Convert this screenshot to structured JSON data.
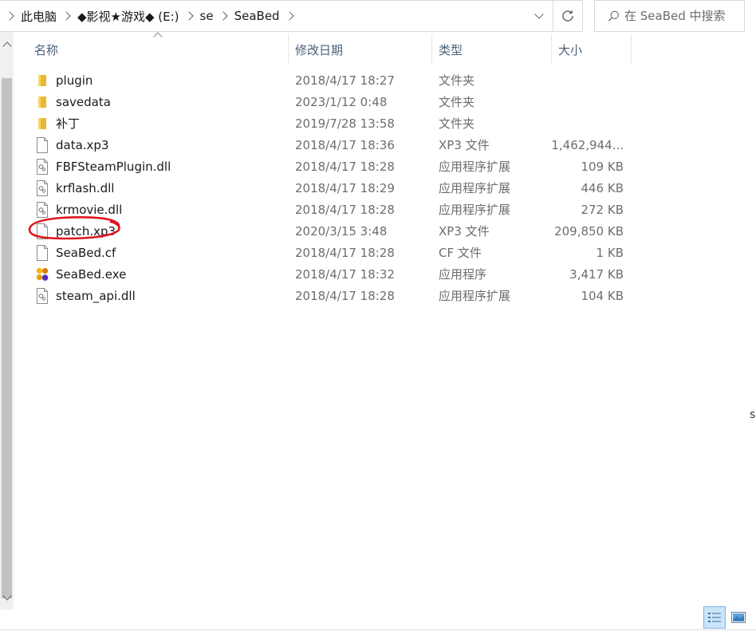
{
  "breadcrumb": [
    {
      "label": "此电脑"
    },
    {
      "label": "◆影视★游戏◆ (E:)"
    },
    {
      "label": "se"
    },
    {
      "label": "SeaBed"
    }
  ],
  "search": {
    "placeholder": "在 SeaBed 中搜索"
  },
  "columns": {
    "name": "名称",
    "date": "修改日期",
    "type": "类型",
    "size": "大小"
  },
  "files": [
    {
      "name": "plugin",
      "date": "2018/4/17 18:27",
      "type": "文件夹",
      "size": "",
      "icon": "folder-icon"
    },
    {
      "name": "savedata",
      "date": "2023/1/12 0:48",
      "type": "文件夹",
      "size": "",
      "icon": "folder-icon"
    },
    {
      "name": "补丁",
      "date": "2019/7/28 13:58",
      "type": "文件夹",
      "size": "",
      "icon": "folder-icon"
    },
    {
      "name": "data.xp3",
      "date": "2018/4/17 18:36",
      "type": "XP3 文件",
      "size": "1,462,944...",
      "icon": "file-icon"
    },
    {
      "name": "FBFSteamPlugin.dll",
      "date": "2018/4/17 18:28",
      "type": "应用程序扩展",
      "size": "109 KB",
      "icon": "dll-icon"
    },
    {
      "name": "krflash.dll",
      "date": "2018/4/17 18:29",
      "type": "应用程序扩展",
      "size": "446 KB",
      "icon": "dll-icon"
    },
    {
      "name": "krmovie.dll",
      "date": "2018/4/17 18:28",
      "type": "应用程序扩展",
      "size": "272 KB",
      "icon": "dll-icon"
    },
    {
      "name": "patch.xp3",
      "date": "2020/3/15 3:48",
      "type": "XP3 文件",
      "size": "209,850 KB",
      "icon": "file-icon"
    },
    {
      "name": "SeaBed.cf",
      "date": "2018/4/17 18:28",
      "type": "CF 文件",
      "size": "1 KB",
      "icon": "file-icon"
    },
    {
      "name": "SeaBed.exe",
      "date": "2018/4/17 18:32",
      "type": "应用程序",
      "size": "3,417 KB",
      "icon": "exe-icon"
    },
    {
      "name": "steam_api.dll",
      "date": "2018/4/17 18:28",
      "type": "应用程序扩展",
      "size": "104 KB",
      "icon": "dll-icon"
    }
  ],
  "edge_glyph": "s",
  "colors": {
    "header_text": "#4c607a",
    "secondary_text": "#6d6d6d",
    "folder": "#e8b830",
    "annotation": "#e0141e",
    "selected_view": "#cce4f7"
  }
}
